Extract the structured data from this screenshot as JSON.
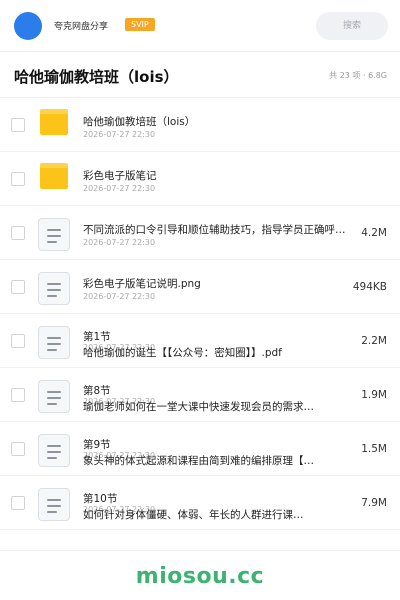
{
  "header": {
    "sharer_name": "夸克网盘分享",
    "vip_badge": "SVIP",
    "search_label": "搜索",
    "avatar_color": "#2b7de9"
  },
  "folder": {
    "title": "哈他瑜伽教培班（lois）",
    "meta": "共 23 项 · 6.8G"
  },
  "items": [
    {
      "type": "folder",
      "icon": "folder-icon",
      "name": "哈他瑜伽教培班（lois）",
      "date": "2026-07-27 22:30",
      "size": ""
    },
    {
      "type": "folder",
      "icon": "folder-icon",
      "name": "彩色电子版笔记",
      "date": "2026-07-27 22:30",
      "size": ""
    },
    {
      "type": "file",
      "icon": "document-icon",
      "name": "不同流派的口令引导和顺位辅助技巧，指导学员正确呼吸…",
      "date": "2026-07-27 22:30",
      "size": "4.2M"
    },
    {
      "type": "file",
      "icon": "document-icon",
      "name": "彩色电子版笔记说明.png",
      "date": "2026-07-27 22:30",
      "size": "494KB"
    },
    {
      "type": "file",
      "icon": "document-icon",
      "name_line1": "第1节",
      "name_line2": "哈他瑜伽的诞生【【公众号：密知圈】】.pdf",
      "date": "2026-07-27 22:30",
      "size": "2.2M"
    },
    {
      "type": "file",
      "icon": "document-icon",
      "name_line1": "第8节",
      "name_line2": "瑜伽老师如何在一堂大课中快速发现会员的需求…",
      "date": "2026-07-27 22:30",
      "size": "1.9M"
    },
    {
      "type": "file",
      "icon": "document-icon",
      "name_line1": "第9节",
      "name_line2": "象头神的体式起源和课程由简到难的编排原理【…",
      "date": "2026-07-27 22:30",
      "size": "1.5M"
    },
    {
      "type": "file",
      "icon": "document-icon",
      "name_line1": "第10节",
      "name_line2": "如何针对身体僵硬、体弱、年长的人群进行课…",
      "date": "2026-07-27 22:30",
      "size": "7.9M"
    }
  ],
  "watermark": "miosou.cc",
  "colors": {
    "accent": "#2b7de9",
    "vip": "#f5a623",
    "folder": "#fcc419",
    "watermark": "#3cb371"
  }
}
